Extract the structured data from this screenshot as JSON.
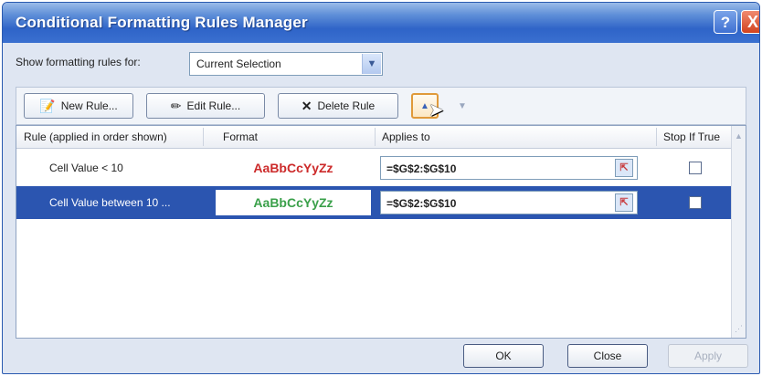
{
  "window": {
    "title": "Conditional Formatting Rules Manager",
    "help_label": "?",
    "close_label": "X"
  },
  "filter": {
    "label": "Show formatting rules for:",
    "selected": "Current Selection"
  },
  "toolbar": {
    "new_rule": "New Rule...",
    "edit_rule": "Edit Rule...",
    "delete_rule": "Delete Rule"
  },
  "table": {
    "headers": {
      "rule": "Rule (applied in order shown)",
      "format": "Format",
      "applies": "Applies to",
      "stop": "Stop If True"
    },
    "rows": [
      {
        "rule": "Cell Value < 10",
        "format_preview": "AaBbCcYyZz",
        "format_color": "#cc2a2a",
        "applies_to": "=$G$2:$G$10",
        "stop_if_true": false,
        "selected": false
      },
      {
        "rule": "Cell Value between 10 ...",
        "format_preview": "AaBbCcYyZz",
        "format_color": "#3aa04a",
        "applies_to": "=$G$2:$G$10",
        "stop_if_true": false,
        "selected": true
      }
    ]
  },
  "footer": {
    "ok": "OK",
    "close": "Close",
    "apply": "Apply"
  }
}
